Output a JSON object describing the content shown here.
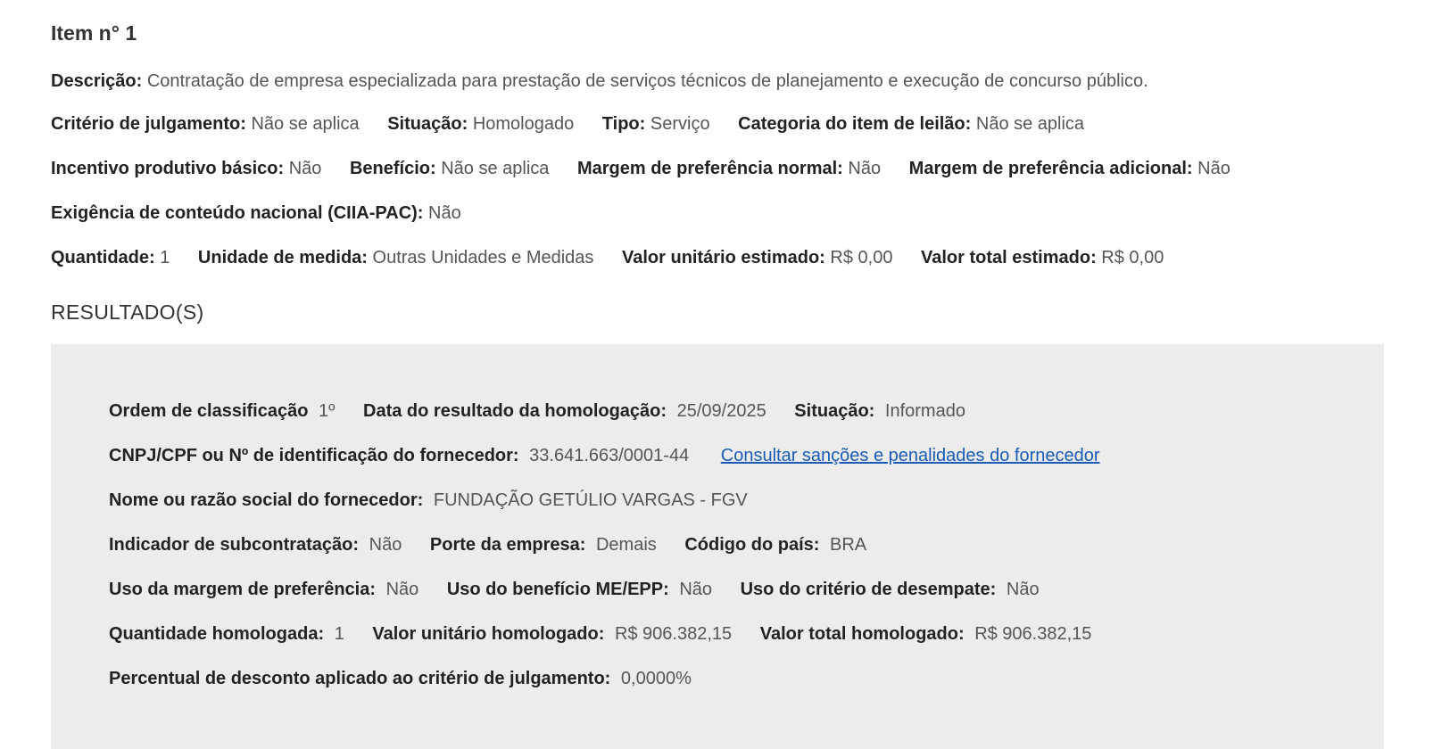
{
  "item": {
    "title": "Item n° 1",
    "descricao_label": "Descrição:",
    "descricao": "Contratação de empresa especializada para prestação de serviços técnicos de planejamento e execução de concurso público.",
    "criterio_label": "Critério de julgamento:",
    "criterio": "Não se aplica",
    "situacao_label": "Situação:",
    "situacao": "Homologado",
    "tipo_label": "Tipo:",
    "tipo": "Serviço",
    "categoria_label": "Categoria do item de leilão:",
    "categoria": "Não se aplica",
    "incentivo_label": "Incentivo produtivo básico:",
    "incentivo": "Não",
    "beneficio_label": "Benefício:",
    "beneficio": "Não se aplica",
    "margem_normal_label": "Margem de preferência normal:",
    "margem_normal": "Não",
    "margem_adicional_label": "Margem de preferência adicional:",
    "margem_adicional": "Não",
    "exigencia_label": "Exigência de conteúdo nacional (CIIA-PAC):",
    "exigencia": "Não",
    "quantidade_label": "Quantidade:",
    "quantidade": "1",
    "unidade_label": "Unidade de medida:",
    "unidade": "Outras Unidades e Medidas",
    "valor_unitario_label": "Valor unitário estimado:",
    "valor_unitario": "R$ 0,00",
    "valor_total_label": "Valor total estimado:",
    "valor_total": "R$ 0,00"
  },
  "resultados_heading": "RESULTADO(S)",
  "resultado": {
    "ordem_label": "Ordem de classificação",
    "ordem": "1º",
    "data_label": "Data do resultado da homologação:",
    "data": "25/09/2025",
    "situacao_label": "Situação:",
    "situacao": "Informado",
    "cnpj_label": "CNPJ/CPF ou Nº de identificação do fornecedor:",
    "cnpj": "33.641.663/0001-44",
    "sancoes_link": "Consultar sanções e penalidades do fornecedor",
    "nome_label": "Nome ou razão social do fornecedor:",
    "nome": "FUNDAÇÃO GETÚLIO VARGAS - FGV",
    "subcontratacao_label": "Indicador de subcontratação:",
    "subcontratacao": "Não",
    "porte_label": "Porte da empresa:",
    "porte": "Demais",
    "pais_label": "Código do país:",
    "pais": "BRA",
    "uso_margem_label": "Uso da margem de preferência:",
    "uso_margem": "Não",
    "uso_beneficio_label": "Uso do benefício ME/EPP:",
    "uso_beneficio": "Não",
    "uso_desempate_label": "Uso do critério de desempate:",
    "uso_desempate": "Não",
    "qtd_homologada_label": "Quantidade homologada:",
    "qtd_homologada": "1",
    "valor_unitario_label": "Valor unitário homologado:",
    "valor_unitario": "R$ 906.382,15",
    "valor_total_label": "Valor total homologado:",
    "valor_total": "R$ 906.382,15",
    "percentual_label": "Percentual de desconto aplicado ao critério de julgamento:",
    "percentual": "0,0000%"
  }
}
